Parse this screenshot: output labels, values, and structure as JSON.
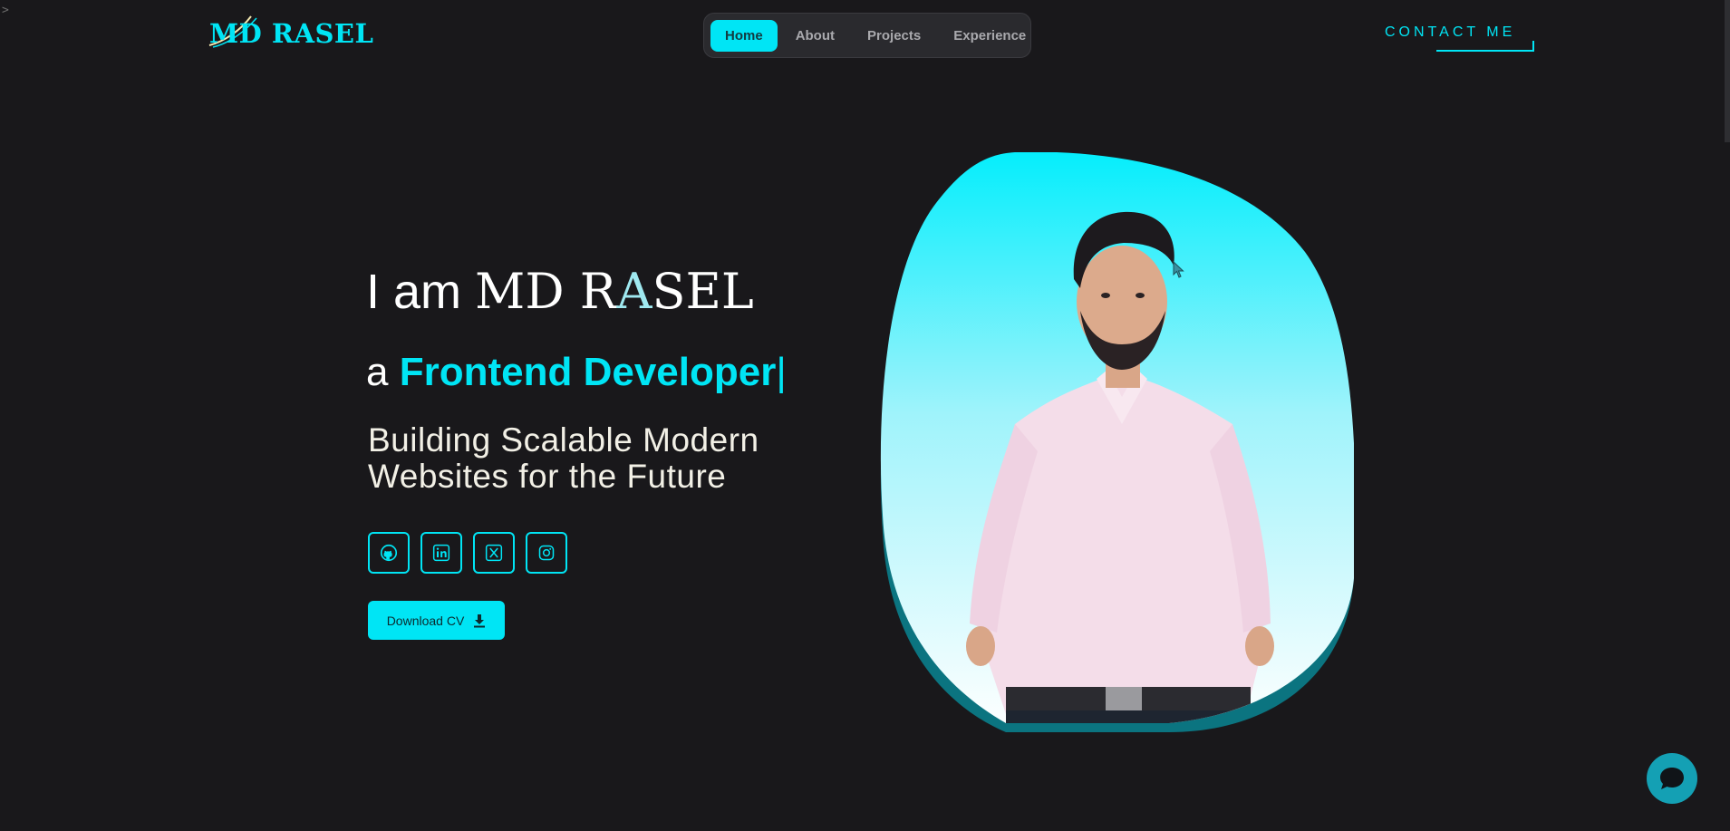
{
  "corner_glyph": ">",
  "logo": {
    "text": "MD RASEL"
  },
  "nav": {
    "items": [
      "Home",
      "About",
      "Projects",
      "Experience"
    ],
    "active": "Home"
  },
  "contact": {
    "label": "CONTACT ME"
  },
  "hero": {
    "intro": "I am",
    "name_part1": "MD R",
    "name_part2": "A",
    "name_part3": "SEL",
    "article": "a",
    "role": "Frontend Developer",
    "cursor": "|",
    "tagline_line1": "Building Scalable Modern",
    "tagline_line2": "Websites for the Future"
  },
  "socials": [
    {
      "icon": "github-icon"
    },
    {
      "icon": "linkedin-icon"
    },
    {
      "icon": "x-twitter-icon"
    },
    {
      "icon": "instagram-icon"
    }
  ],
  "cv_button": {
    "label": "Download CV",
    "icon": "download-icon"
  },
  "chat": {
    "icon": "chat-bubble-icon"
  },
  "colors": {
    "accent": "#00e5f5",
    "background": "#19181b",
    "nav_bg": "#2a2a2e",
    "chat": "#14a0b4"
  }
}
